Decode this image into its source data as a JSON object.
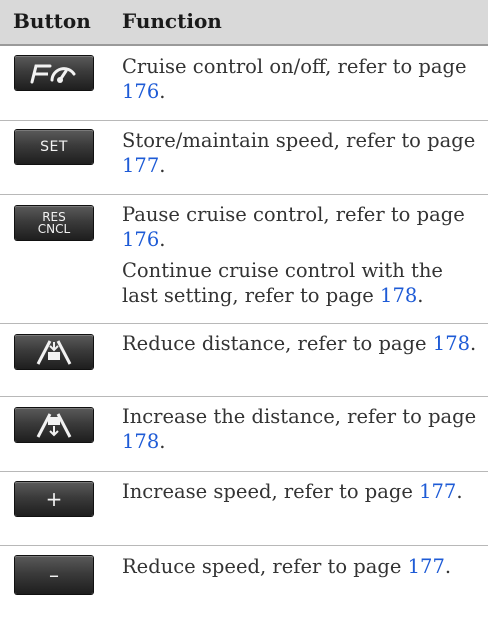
{
  "header": {
    "col_button": "Button",
    "col_function": "Function"
  },
  "rows": [
    {
      "icon": "cruise-control-icon",
      "text": "Cruise control on/off, refer to page ",
      "page": "176",
      "suffix": "."
    },
    {
      "icon_label": "SET",
      "text": "Store/maintain speed, refer to page ",
      "page": "177",
      "suffix": "."
    },
    {
      "icon_label_line1": "RES",
      "icon_label_line2": "CNCL",
      "text": "Pause cruise control, refer to page ",
      "page": "176",
      "suffix": ".",
      "text2": "Continue cruise control with the last setting, refer to page ",
      "page2": "178",
      "suffix2": "."
    },
    {
      "icon": "reduce-distance-icon",
      "text": "Reduce distance, refer to page ",
      "page": "178",
      "suffix": "."
    },
    {
      "icon": "increase-distance-icon",
      "text": "Increase the distance, refer to page ",
      "page": "178",
      "suffix": "."
    },
    {
      "icon_label": "+",
      "text": "Increase speed, refer to page ",
      "page": "177",
      "suffix": "."
    },
    {
      "icon_label": "–",
      "text": "Reduce speed, refer to page ",
      "page": "177",
      "suffix": "."
    }
  ]
}
